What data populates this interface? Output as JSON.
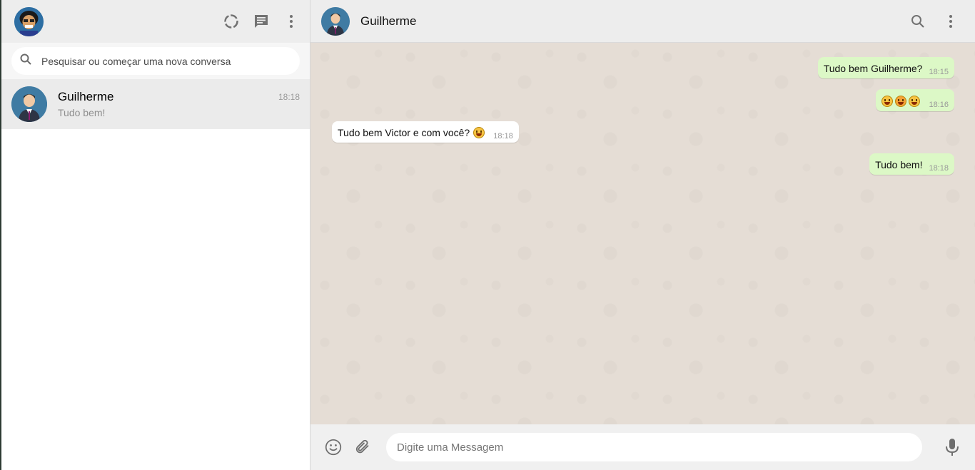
{
  "sidebar": {
    "search": {
      "placeholder": "Pesquisar ou começar uma nova conversa"
    },
    "icons": {
      "status": "status-ring-icon",
      "new_chat": "message-icon",
      "menu": "more-vert-icon",
      "search": "search-icon"
    },
    "chats": [
      {
        "name": "Guilherme",
        "time": "18:18",
        "last_message": "Tudo bem!"
      }
    ]
  },
  "conversation": {
    "contact_name": "Guilherme",
    "icons": {
      "search": "search-icon",
      "menu": "more-vert-icon"
    },
    "messages": [
      {
        "direction": "out",
        "text": "Tudo bem Guilherme?",
        "time": "18:15"
      },
      {
        "direction": "out",
        "text": "",
        "emojis": [
          "smiley-face",
          "face-with-tongue",
          "grinning-face"
        ],
        "time": "18:16"
      },
      {
        "direction": "in",
        "text": "Tudo bem Victor e com você?",
        "emojis": [
          "grinning-face-with-big-eyes"
        ],
        "time": "18:18"
      },
      {
        "direction": "out",
        "text": "Tudo bem!",
        "time": "18:18"
      }
    ]
  },
  "composer": {
    "placeholder": "Digite uma Messagem",
    "icons": {
      "emoji": "emoji-icon",
      "attach": "paperclip-icon",
      "mic": "microphone-icon"
    }
  },
  "colors": {
    "outgoing_bubble": "#dcf8c6",
    "incoming_bubble": "#ffffff",
    "chat_background": "#e5ddd5",
    "header": "#ededed"
  }
}
